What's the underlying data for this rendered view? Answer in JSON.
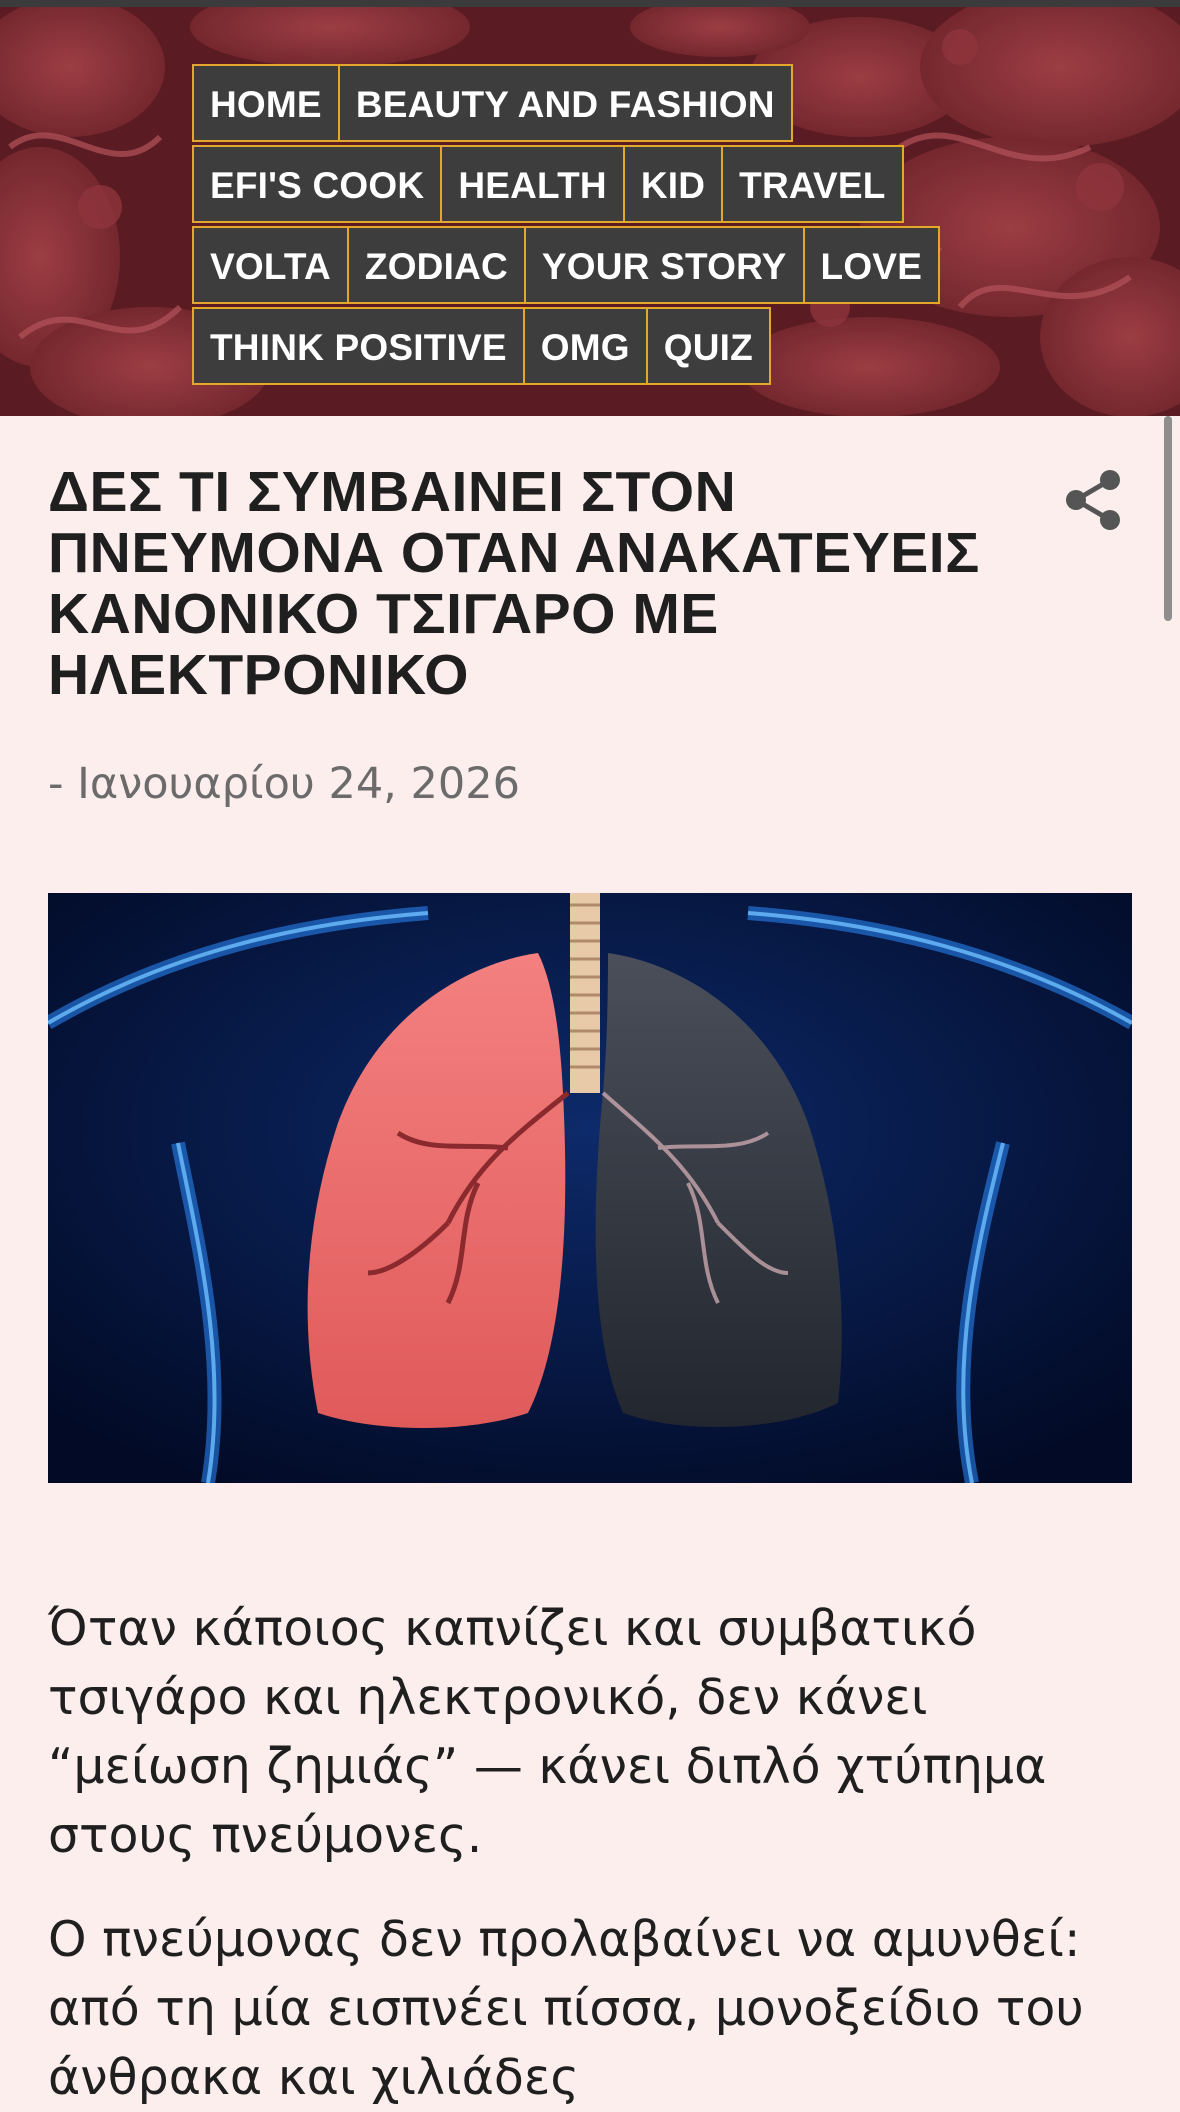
{
  "nav": {
    "rows": [
      [
        "HOME",
        "BEAUTY AND FASHION"
      ],
      [
        "EFI'S COOK",
        "HEALTH",
        "KID",
        "TRAVEL"
      ],
      [
        "VOLTA",
        "ZODIAC",
        "YOUR STORY",
        "LOVE"
      ],
      [
        "THINK POSITIVE",
        "OMG",
        "QUIZ"
      ]
    ]
  },
  "post": {
    "title": "ΔΕΣ ΤΙ ΣΥΜΒΑΙΝΕΙ ΣΤΟΝ ΠΝΕΥΜΟΝΑ ΟΤΑΝ ΑΝΑΚΑΤΕΥΕΙΣ ΚΑΝΟΝΙΚΟ ΤΣΙΓΑΡΟ ΜΕ ΗΛΕΚΤΡΟΝΙΚΟ",
    "date": "- Ιανουαρίου 24, 2026",
    "paragraphs": [
      "Όταν κάποιος καπνίζει και συμβατικό τσιγάρο και ηλεκτρονικό, δεν κάνει “μείωση ζημιάς” — κάνει διπλό χτύπημα στους πνεύμονες.",
      "Ο πνεύμονας δεν προλαβαίνει να αμυνθεί: από τη μία εισπνέει πίσσα, μονοξείδιο του άνθρακα και χιλιάδες"
    ]
  },
  "icons": {
    "share": "share-icon"
  },
  "colors": {
    "nav_bg": "#3d3d3d",
    "nav_border": "#e3a82a",
    "header_bg": "#5a1b22",
    "page_bg": "#fdeeee"
  }
}
